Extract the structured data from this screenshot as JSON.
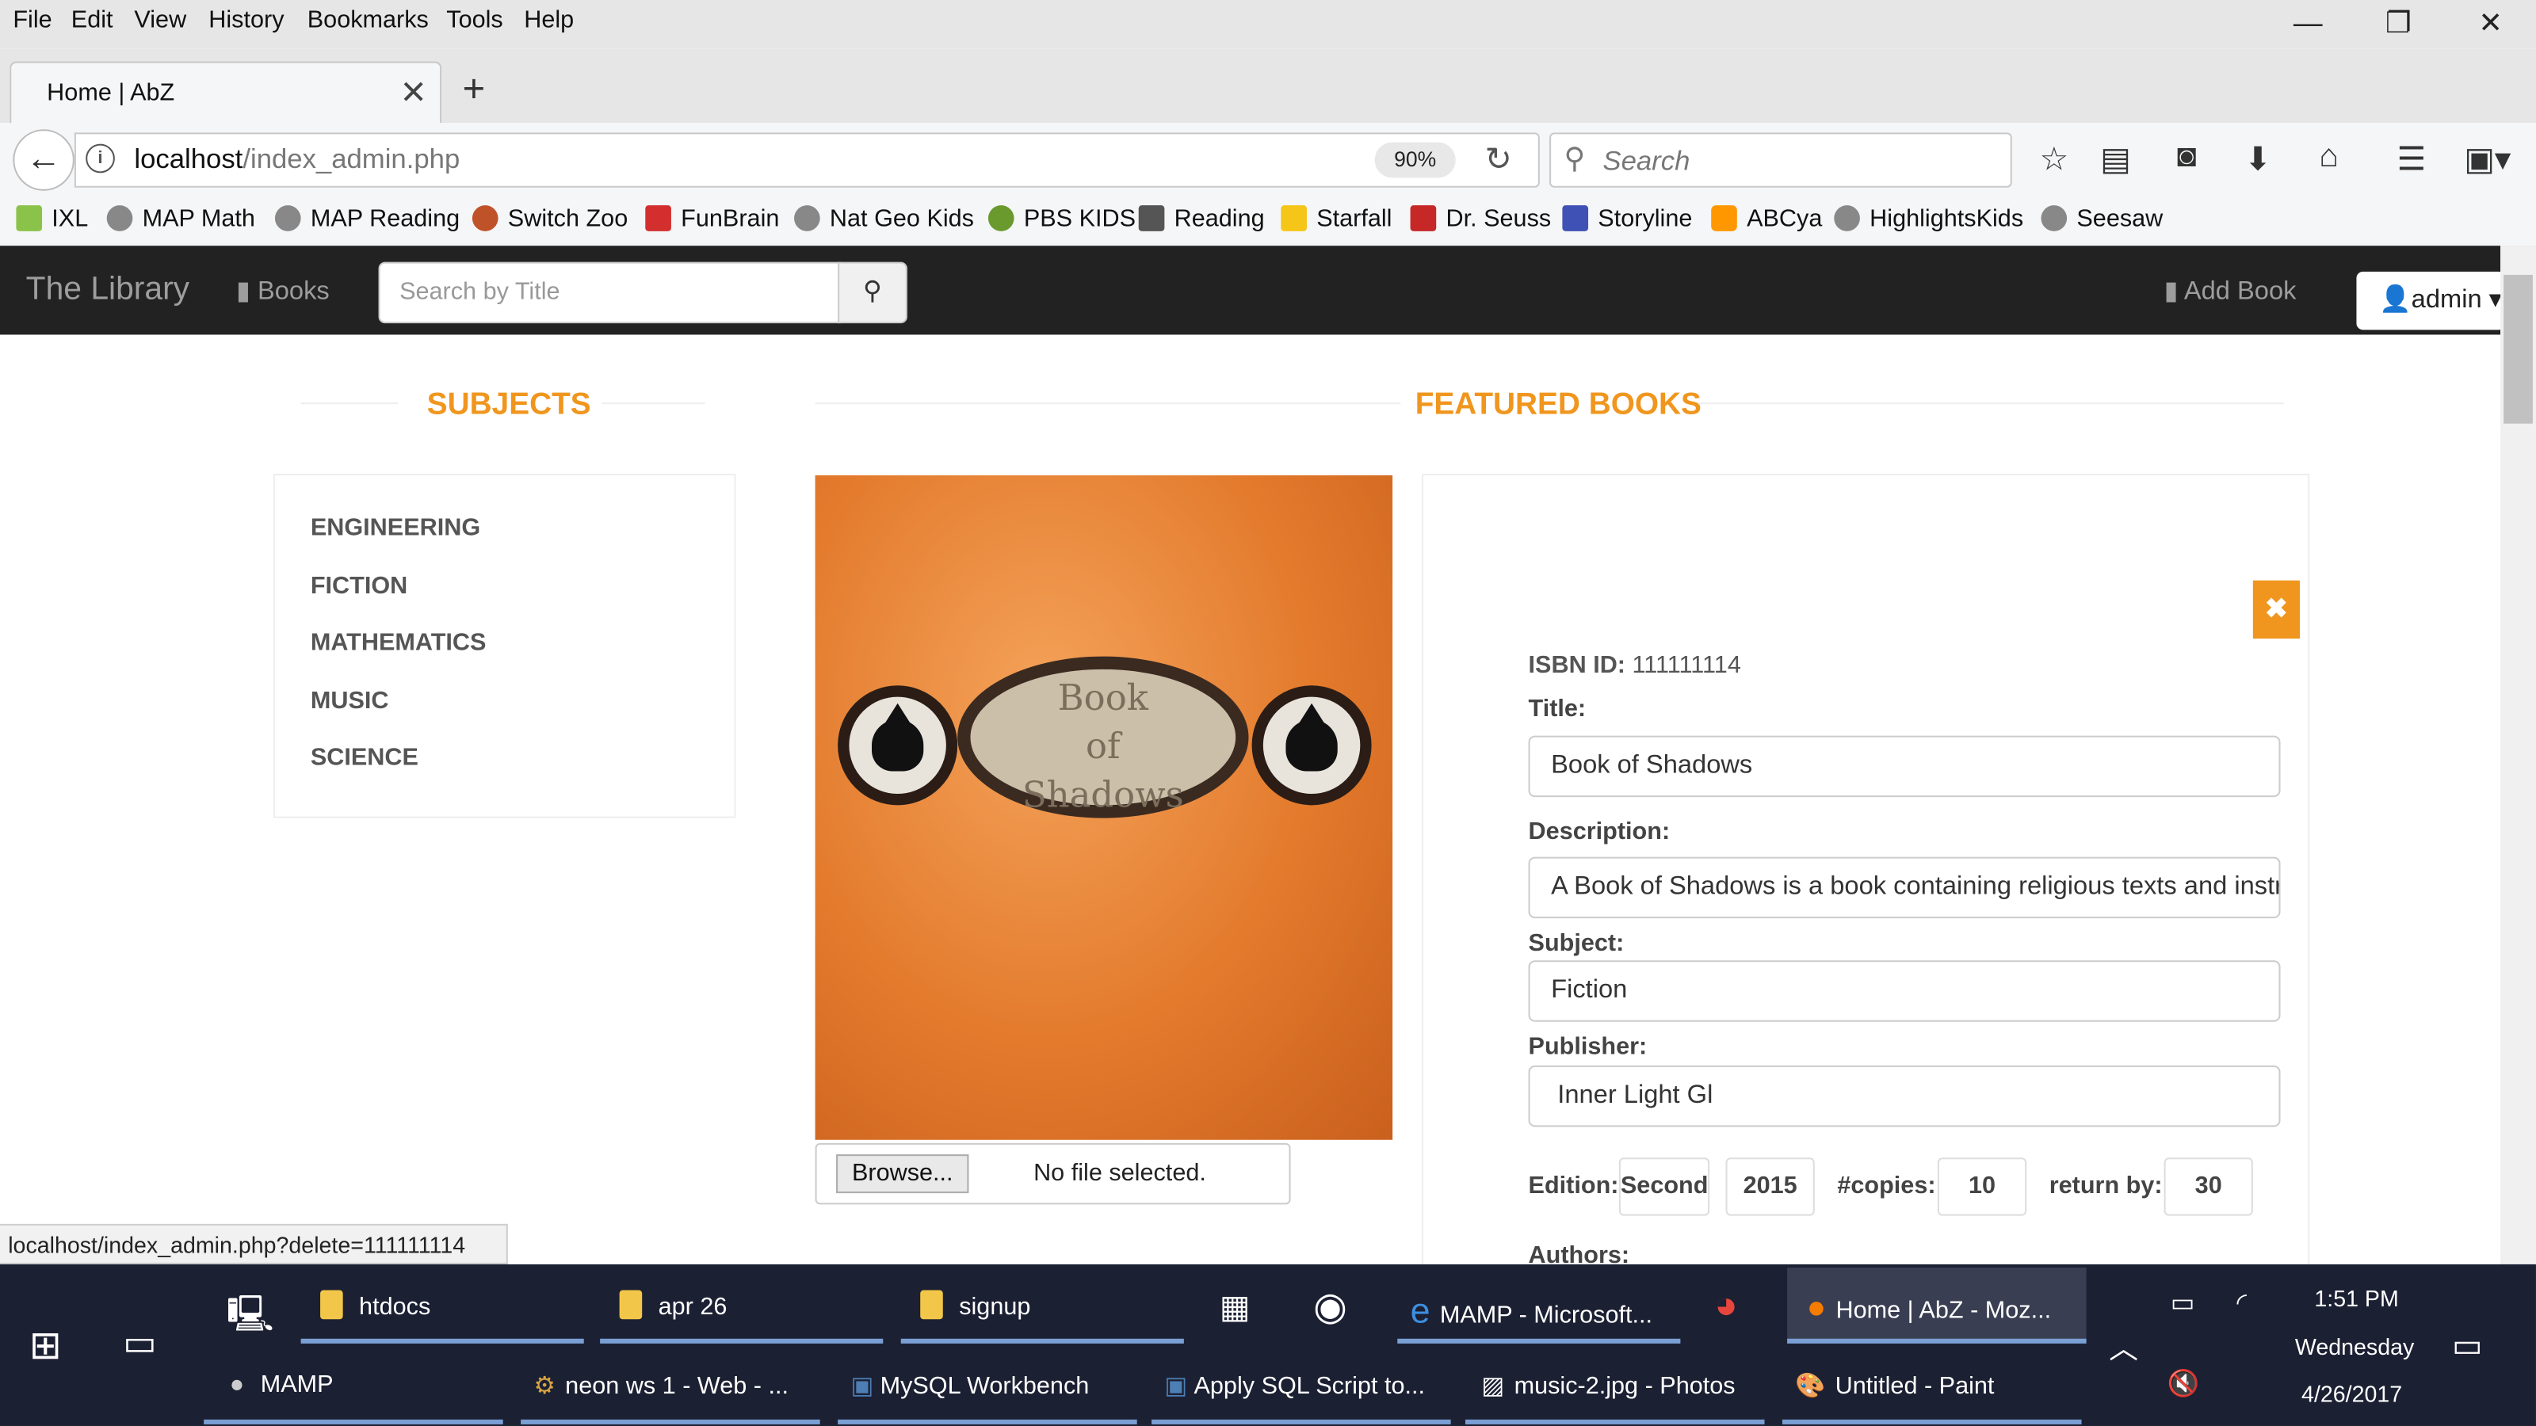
{
  "menu": [
    "File",
    "Edit",
    "View",
    "History",
    "Bookmarks",
    "Tools",
    "Help"
  ],
  "tab": {
    "title": "Home | AbZ"
  },
  "address": {
    "host": "localhost",
    "path": "/index_admin.php",
    "zoom": "90%"
  },
  "browser_search": {
    "placeholder": "Search"
  },
  "bookmarks": [
    "IXL",
    "MAP Math",
    "MAP Reading",
    "Switch Zoo",
    "FunBrain",
    "Nat Geo Kids",
    "PBS KIDS",
    "Reading",
    "Starfall",
    "Dr. Seuss",
    "Storyline",
    "ABCya",
    "HighlightsKids",
    "Seesaw"
  ],
  "site": {
    "brand": "The Library",
    "nav_books": "Books",
    "search_placeholder": "Search by Title",
    "add_book": "Add Book",
    "user": "admin"
  },
  "subjects": {
    "heading": "SUBJECTS",
    "items": [
      "ENGINEERING",
      "FICTION",
      "MATHEMATICS",
      "MUSIC",
      "SCIENCE"
    ]
  },
  "featured": {
    "heading": "FEATURED BOOKS",
    "cover_text": [
      "Book",
      "of",
      "Shadows"
    ],
    "browse": "Browse...",
    "no_file": "No file selected.",
    "isbn_label": "ISBN ID:",
    "isbn": "111111114",
    "title_label": "Title:",
    "title": "Book of Shadows",
    "description_label": "Description:",
    "description": "A Book of Shadows is a book containing religious texts and instru",
    "subject_label": "Subject:",
    "subject": "Fiction",
    "publisher_label": "Publisher:",
    "publisher": "Inner Light Gl",
    "edition_label": "Edition:",
    "edition": "Second",
    "year": "2015",
    "copies_label": "#copies:",
    "copies": "10",
    "return_label": "return by:",
    "return_by": "30",
    "authors_label": "Authors:"
  },
  "status_url": "localhost/index_admin.php?delete=111111114",
  "taskbar": {
    "row1": [
      "htdocs",
      "apr 26",
      "signup",
      "MAMP - Microsoft...",
      "Home | AbZ - Moz..."
    ],
    "row2": [
      "MAMP",
      "neon ws 1 - Web - ...",
      "MySQL Workbench",
      "Apply SQL Script to...",
      "music-2.jpg - Photos",
      "Untitled - Paint"
    ],
    "time": "1:51 PM",
    "day": "Wednesday",
    "date": "4/26/2017"
  },
  "colors": {
    "accent": "#f0961e",
    "navbar": "#222222",
    "taskbar": "#1c2033"
  }
}
